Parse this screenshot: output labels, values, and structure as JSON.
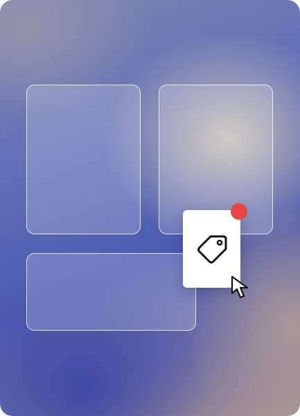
{
  "colors": {
    "notification": "#e84545",
    "popover_bg": "#ffffff",
    "card_border": "rgba(255,255,255,0.78)",
    "icon_stroke": "#111111"
  },
  "icons": {
    "popover": "tag-icon",
    "pointer": "mouse-pointer-icon",
    "badge": "notification-dot"
  }
}
